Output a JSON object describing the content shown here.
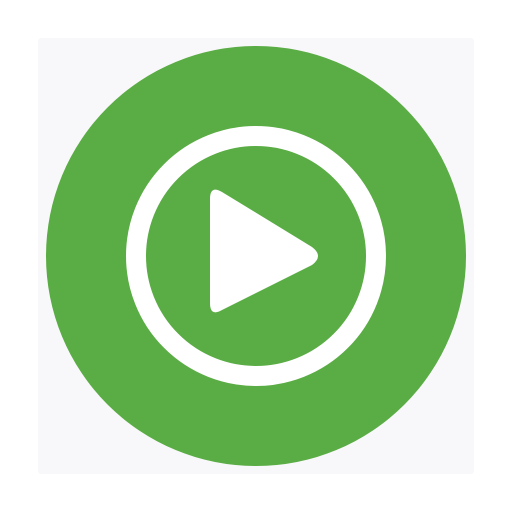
{
  "app_icon": {
    "icon": "play-circle-icon",
    "background_color": "#f8f8fa",
    "circle_color": "#5aac44",
    "glyph_color": "#ffffff"
  }
}
